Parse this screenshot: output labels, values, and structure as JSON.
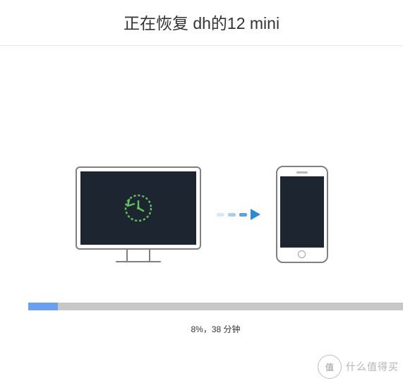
{
  "header": {
    "title": "正在恢复 dh的12 mini"
  },
  "transfer": {
    "source_icon": "time-machine-backup-icon",
    "arrow_icon": "transfer-arrow-icon",
    "target_icon": "iphone-icon"
  },
  "progress": {
    "percent": 8,
    "status_text": "8%，38 分钟"
  },
  "watermark": {
    "badge": "值",
    "text": "什么值得买"
  }
}
